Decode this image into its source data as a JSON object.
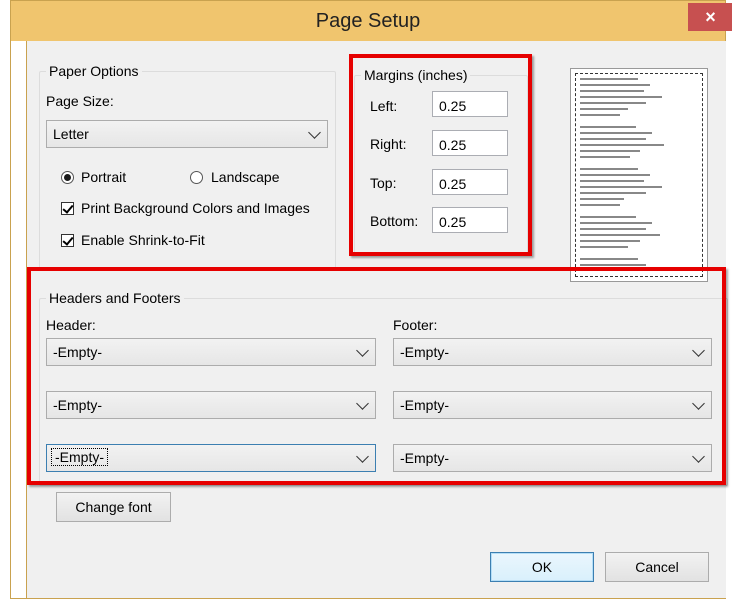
{
  "window": {
    "title": "Page Setup",
    "close_glyph": "×"
  },
  "paper_options": {
    "legend": "Paper Options",
    "page_size_label": "Page Size:",
    "page_size_value": "Letter",
    "portrait_label": "Portrait",
    "landscape_label": "Landscape",
    "orientation_selected": "Portrait",
    "print_background_label": "Print Background Colors and Images",
    "print_background_checked": true,
    "shrink_to_fit_label": "Enable Shrink-to-Fit",
    "shrink_to_fit_checked": true
  },
  "margins": {
    "legend": "Margins (inches)",
    "left_label": "Left:",
    "left_value": "0.25",
    "right_label": "Right:",
    "right_value": "0.25",
    "top_label": "Top:",
    "top_value": "0.25",
    "bottom_label": "Bottom:",
    "bottom_value": "0.25"
  },
  "headers_footers": {
    "legend": "Headers and Footers",
    "header_label": "Header:",
    "footer_label": "Footer:",
    "header_values": [
      "-Empty-",
      "-Empty-",
      "-Empty-"
    ],
    "footer_values": [
      "-Empty-",
      "-Empty-",
      "-Empty-"
    ]
  },
  "buttons": {
    "change_font": "Change font",
    "ok": "OK",
    "cancel": "Cancel"
  },
  "colors": {
    "titlebar": "#f0c56e",
    "close_button": "#c75050",
    "highlight": "#e60000",
    "dialog_bg": "#f0f0f0"
  },
  "icons": {
    "close": "close-icon",
    "dropdown": "chevron-down-icon",
    "checkbox": "checkmark-icon",
    "radio": "radio-dot-icon"
  }
}
